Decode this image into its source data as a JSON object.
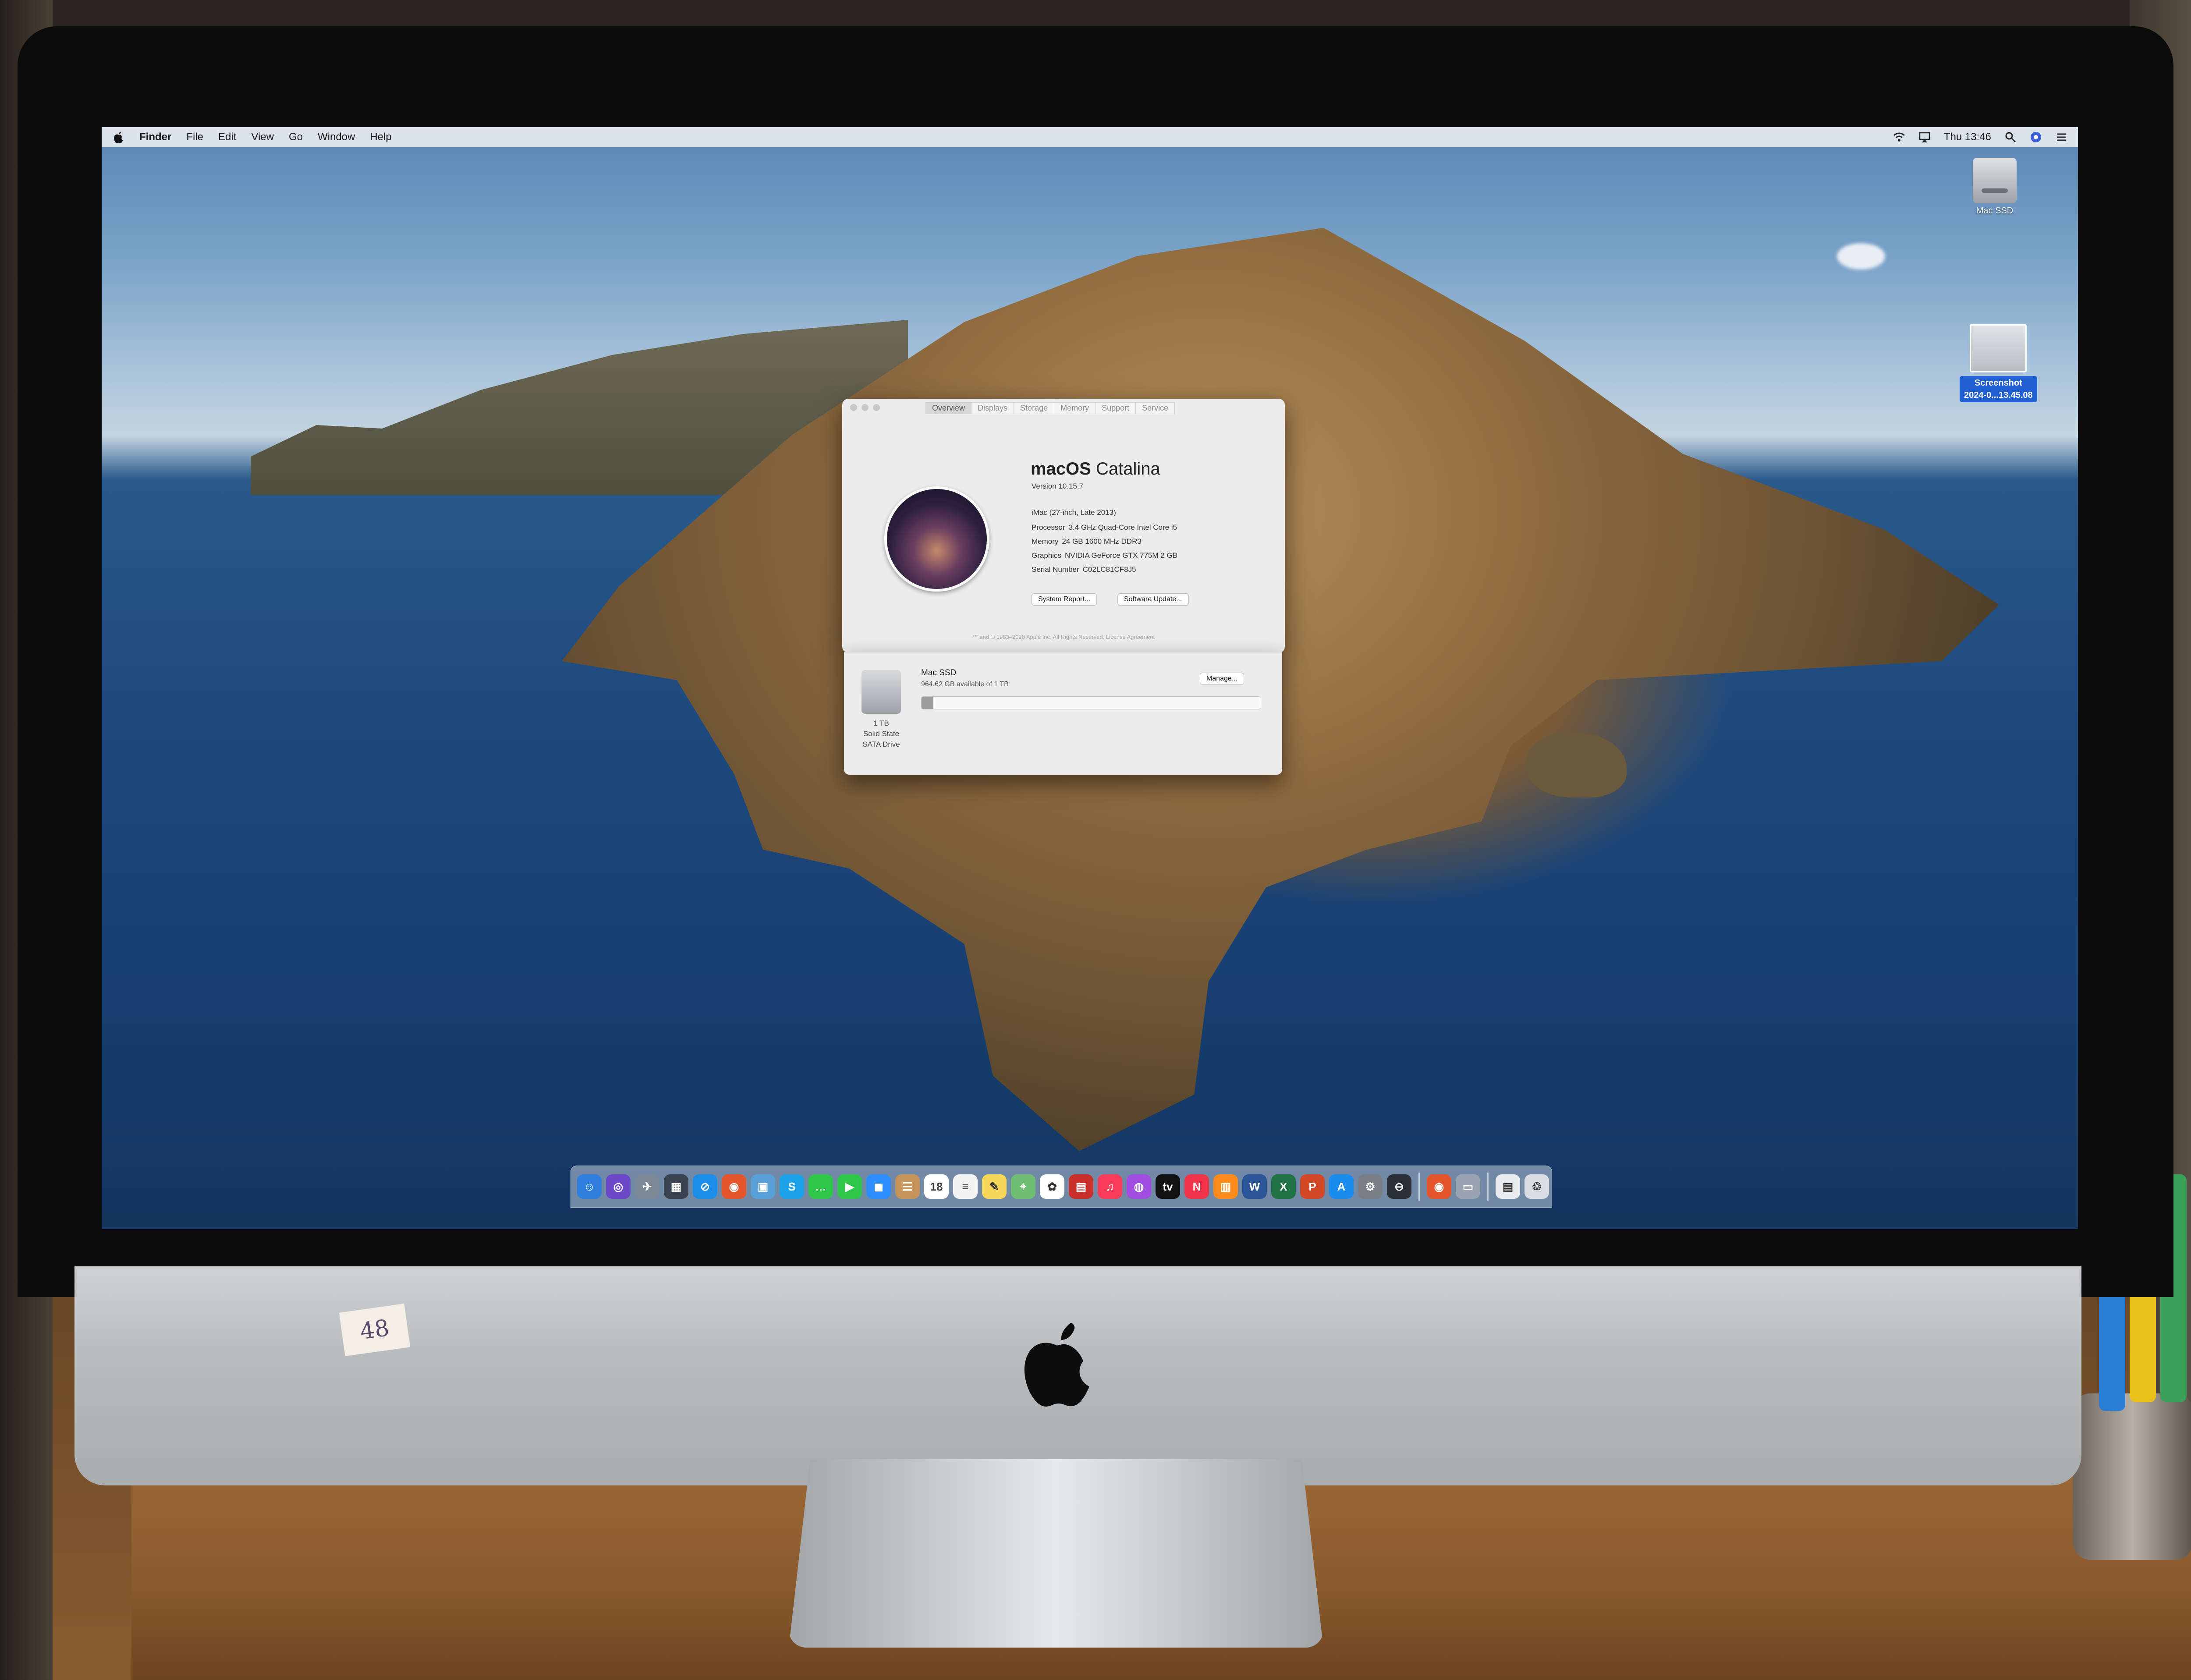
{
  "menubar": {
    "app_name": "Finder",
    "menus": [
      "File",
      "Edit",
      "View",
      "Go",
      "Window",
      "Help"
    ],
    "clock": "Thu 13:46"
  },
  "desktop": {
    "hdd_label": "Mac SSD",
    "screenshot_label_line1": "Screenshot",
    "screenshot_label_line2": "2024-0...13.45.08"
  },
  "about_window": {
    "tabs": [
      "Overview",
      "Displays",
      "Storage",
      "Memory",
      "Support",
      "Service"
    ],
    "active_tab": "Overview",
    "os_name_bold": "macOS",
    "os_name_light": "Catalina",
    "version": "Version 10.15.7",
    "model": "iMac (27-inch, Late 2013)",
    "specs": [
      {
        "key": "Processor",
        "value": "3.4 GHz Quad-Core Intel Core i5"
      },
      {
        "key": "Memory",
        "value": "24 GB 1600 MHz DDR3"
      },
      {
        "key": "Graphics",
        "value": "NVIDIA GeForce GTX 775M 2 GB"
      },
      {
        "key": "Serial Number",
        "value": "C02LC81CF8J5"
      }
    ],
    "buttons": {
      "system_report": "System Report...",
      "software_update": "Software Update..."
    },
    "copyright": "™ and © 1983–2020 Apple Inc. All Rights Reserved. License Agreement"
  },
  "storage": {
    "disk_name": "Mac SSD",
    "available": "964.62 GB available of 1 TB",
    "manage_label": "Manage...",
    "drive_size": "1 TB",
    "drive_type_line1": "Solid State",
    "drive_type_line2": "SATA Drive",
    "used_fraction": 0.035
  },
  "dock": {
    "apps": [
      {
        "name": "finder-icon",
        "color": "#2f7fe0",
        "glyph": "☺"
      },
      {
        "name": "siri-icon",
        "color": "#6a48c8",
        "glyph": "◎"
      },
      {
        "name": "launchpad-icon",
        "color": "#7d8896",
        "glyph": "✈"
      },
      {
        "name": "mission-control-icon",
        "color": "#3b4250",
        "glyph": "▦"
      },
      {
        "name": "safari-icon",
        "color": "#1d8ee8",
        "glyph": "⊘"
      },
      {
        "name": "firefox-icon",
        "color": "#e4552b",
        "glyph": "◉"
      },
      {
        "name": "preview-icon",
        "color": "#5aa0d8",
        "glyph": "▣"
      },
      {
        "name": "skype-icon",
        "color": "#1aa3e8",
        "glyph": "S"
      },
      {
        "name": "messages-icon",
        "color": "#2fc74a",
        "glyph": "…"
      },
      {
        "name": "facetime-icon",
        "color": "#2fc74a",
        "glyph": "▶"
      },
      {
        "name": "zoom-icon",
        "color": "#2d8cff",
        "glyph": "◼"
      },
      {
        "name": "contacts-icon",
        "color": "#c4935a",
        "glyph": "☰"
      },
      {
        "name": "calendar-icon",
        "color": "#ffffff",
        "glyph": "18"
      },
      {
        "name": "reminders-icon",
        "color": "#f2f2f2",
        "glyph": "≡"
      },
      {
        "name": "notes-icon",
        "color": "#f6d75a",
        "glyph": "✎"
      },
      {
        "name": "maps-icon",
        "color": "#6fbf73",
        "glyph": "⌖"
      },
      {
        "name": "photos-icon",
        "color": "#ffffff",
        "glyph": "✿"
      },
      {
        "name": "photo-booth-icon",
        "color": "#c9302c",
        "glyph": "▤"
      },
      {
        "name": "music-icon",
        "color": "#fa3c5a",
        "glyph": "♫"
      },
      {
        "name": "podcasts-icon",
        "color": "#a14ee0",
        "glyph": "◍"
      },
      {
        "name": "tv-icon",
        "color": "#111111",
        "glyph": "tv"
      },
      {
        "name": "news-icon",
        "color": "#f0354a",
        "glyph": "N"
      },
      {
        "name": "books-icon",
        "color": "#ff8c1a",
        "glyph": "▥"
      },
      {
        "name": "word-icon",
        "color": "#2b579a",
        "glyph": "W"
      },
      {
        "name": "excel-icon",
        "color": "#217346",
        "glyph": "X"
      },
      {
        "name": "powerpoint-icon",
        "color": "#d24726",
        "glyph": "P"
      },
      {
        "name": "app-store-icon",
        "color": "#1a8cf0",
        "glyph": "A"
      },
      {
        "name": "system-preferences-icon",
        "color": "#7a7f86",
        "glyph": "⚙"
      },
      {
        "name": "utility-icon",
        "color": "#2a2f3a",
        "glyph": "⊖"
      }
    ],
    "recent": [
      {
        "name": "firefox-recent-icon",
        "color": "#e4552b",
        "glyph": "◉"
      },
      {
        "name": "image-capture-icon",
        "color": "#9aa4b0",
        "glyph": "▭"
      }
    ],
    "extras": [
      {
        "name": "downloads-stack-icon",
        "color": "#e9ecef",
        "glyph": "▤"
      },
      {
        "name": "trash-icon",
        "color": "#d9dde2",
        "glyph": "♲"
      }
    ]
  },
  "sticker_text": "48"
}
